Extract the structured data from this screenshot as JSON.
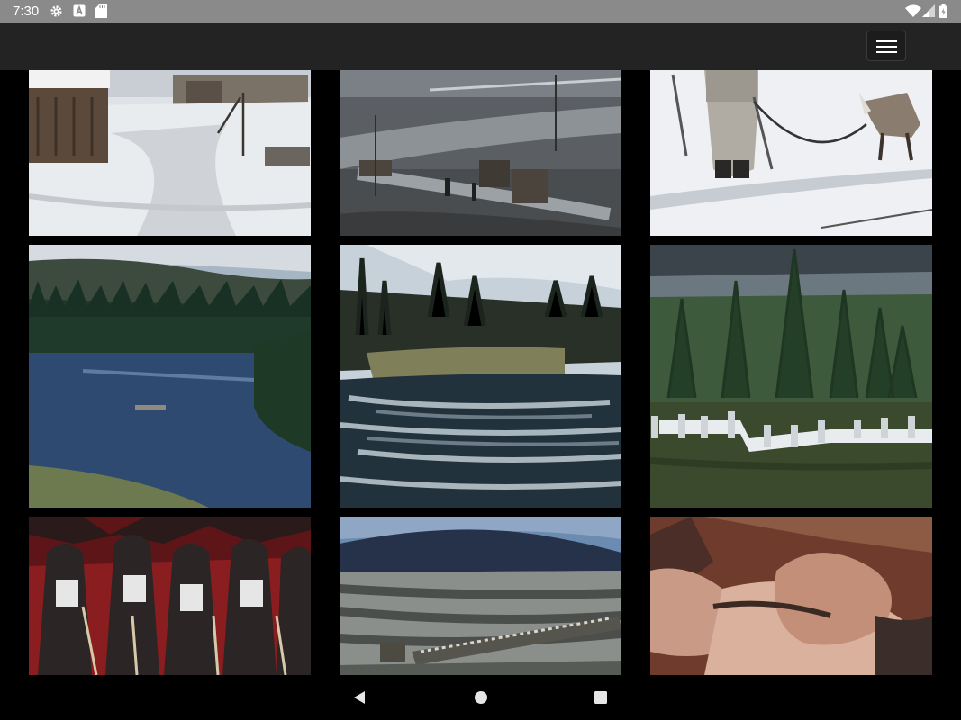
{
  "status_bar": {
    "time": "7:30",
    "left_icons": [
      "settings-icon",
      "a-notification-icon",
      "sd-card-icon"
    ],
    "right_icons": [
      "wifi-icon",
      "cell-signal-icon",
      "battery-icon"
    ]
  },
  "app_bar": {
    "menu_icon": "hamburger-menu-icon"
  },
  "gallery": {
    "photos": [
      {
        "name": "snowy-village-road-photo"
      },
      {
        "name": "trucks-on-road-photo"
      },
      {
        "name": "soldier-with-reindeer-photo"
      },
      {
        "name": "river-valley-photo"
      },
      {
        "name": "rapids-forest-photo"
      },
      {
        "name": "laundry-in-forest-photo"
      },
      {
        "name": "skiers-group-photo"
      },
      {
        "name": "bridge-landscape-photo"
      },
      {
        "name": "resting-man-photo"
      }
    ]
  },
  "nav_bar": {
    "icons": [
      "back-icon",
      "home-icon",
      "recents-icon"
    ]
  }
}
